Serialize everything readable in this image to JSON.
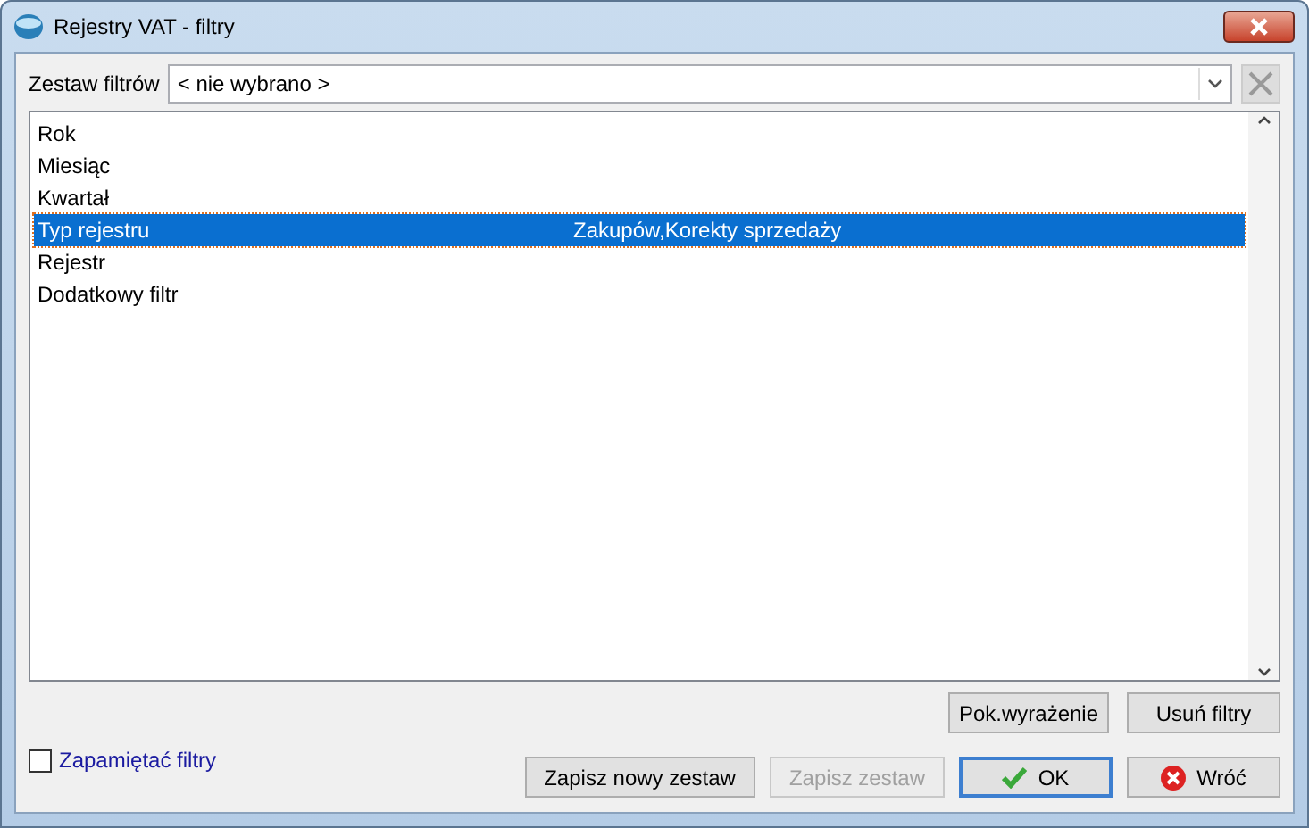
{
  "window": {
    "title": "Rejestry VAT - filtry"
  },
  "filter_set": {
    "label": "Zestaw filtrów",
    "value": "< nie wybrano >"
  },
  "filters": [
    {
      "name": "Rok",
      "selected": false
    },
    {
      "name": "Miesiąc",
      "selected": false
    },
    {
      "name": "Kwartał",
      "selected": false
    },
    {
      "name": "Typ rejestru",
      "value": "Zakupów,Korekty sprzedaży",
      "selected": true
    },
    {
      "name": "Rejestr",
      "selected": false
    },
    {
      "name": "Dodatkowy filtr",
      "selected": false
    }
  ],
  "list_buttons": [
    {
      "label": "Pok.wyrażenie"
    },
    {
      "label": "Usuń filtry"
    }
  ],
  "remember": {
    "label": "Zapamiętać filtry",
    "checked": false
  },
  "buttons": [
    {
      "label": "Zapisz nowy zestaw",
      "kind": "plain",
      "disabled": false
    },
    {
      "label": "Zapisz zestaw",
      "kind": "plain",
      "disabled": true
    },
    {
      "label": "OK",
      "kind": "ok",
      "disabled": false
    },
    {
      "label": "Wróć",
      "kind": "cancel",
      "disabled": false
    }
  ]
}
